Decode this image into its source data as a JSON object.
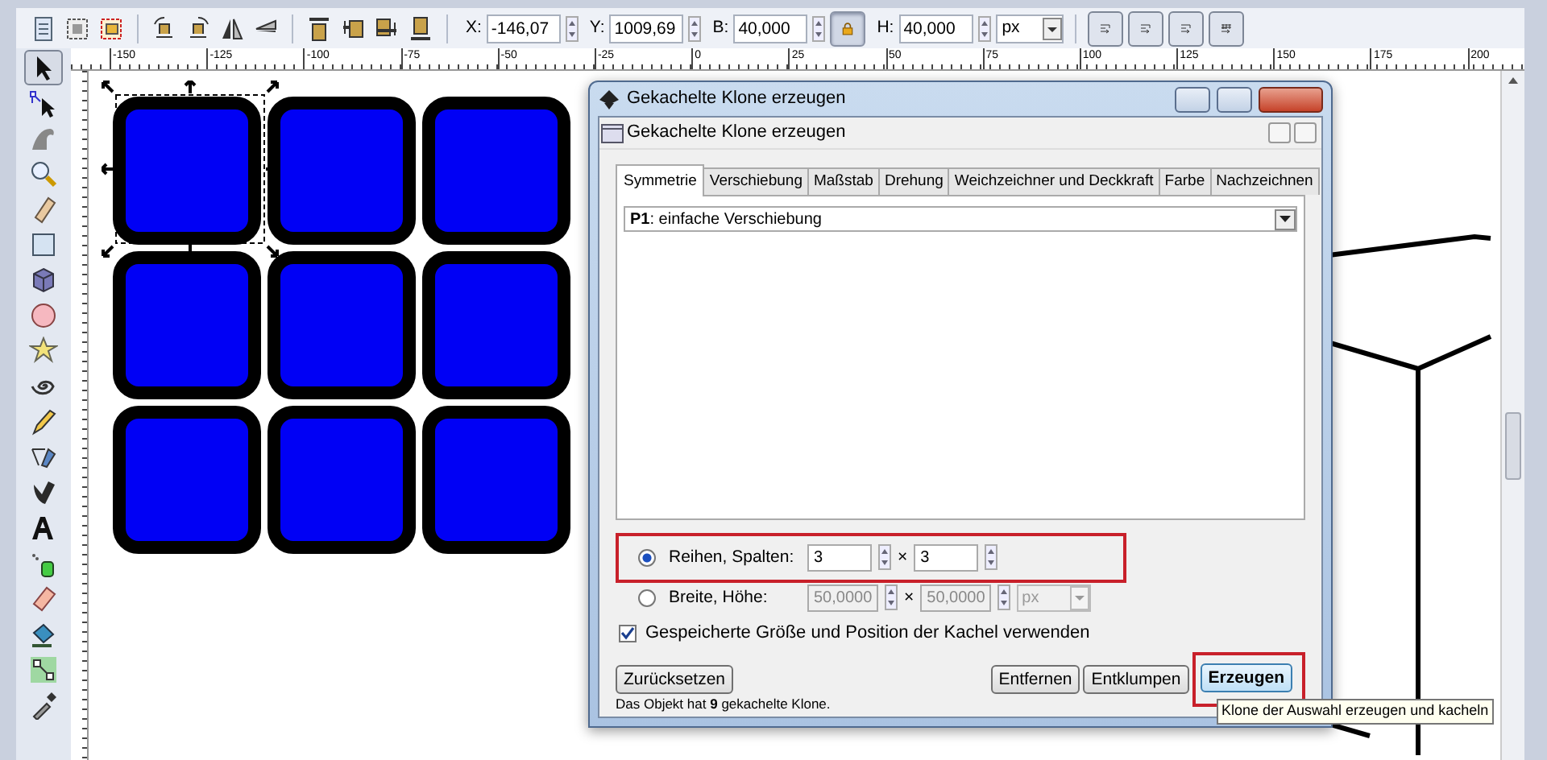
{
  "toolbar": {
    "items": [
      {
        "kind": "field",
        "label": "X:",
        "value": "-146,07"
      },
      {
        "kind": "field",
        "label": "Y:",
        "value": "1009,69"
      },
      {
        "kind": "field",
        "label": "B:",
        "value": "40,000"
      },
      {
        "kind": "lock",
        "on": true
      },
      {
        "kind": "field",
        "label": "H:",
        "value": "40,000"
      },
      {
        "kind": "unit",
        "value": "px"
      }
    ]
  },
  "ruler": {
    "labels": [
      "-150",
      "-125",
      "-100",
      "-75",
      "-50",
      "-25",
      "0",
      "25",
      "50",
      "75",
      "100",
      "125",
      "150",
      "175",
      "200"
    ]
  },
  "toolbox": {
    "tools": [
      {
        "kind": "selector",
        "selected": true
      },
      {
        "kind": "node",
        "selected": false
      },
      {
        "kind": "tweak",
        "selected": false
      },
      {
        "kind": "zoom",
        "selected": false
      },
      {
        "kind": "measure",
        "selected": false
      },
      {
        "kind": "rect",
        "selected": false
      },
      {
        "kind": "box3d",
        "selected": false
      },
      {
        "kind": "circle",
        "selected": false
      },
      {
        "kind": "star",
        "selected": false
      },
      {
        "kind": "spiral",
        "selected": false
      },
      {
        "kind": "pencil",
        "selected": false
      },
      {
        "kind": "pen",
        "selected": false
      },
      {
        "kind": "calligraphy",
        "selected": false
      },
      {
        "kind": "text",
        "selected": false
      },
      {
        "kind": "spray",
        "selected": false
      },
      {
        "kind": "eraser",
        "selected": false
      },
      {
        "kind": "bucket",
        "selected": false
      },
      {
        "kind": "connector",
        "selected": false
      },
      {
        "kind": "dropper",
        "selected": false
      }
    ]
  },
  "dialog": {
    "title": "Gekachelte Klone erzeugen",
    "panel_title": "Gekachelte Klone erzeugen",
    "tabs": [
      {
        "label": "Symmetrie",
        "selected": true
      },
      {
        "label": "Verschiebung",
        "selected": false
      },
      {
        "label": "Maßstab",
        "selected": false
      },
      {
        "label": "Drehung",
        "selected": false
      },
      {
        "label": "Weichzeichner und Deckkraft",
        "selected": false
      },
      {
        "label": "Farbe",
        "selected": false
      },
      {
        "label": "Nachzeichnen",
        "selected": false
      }
    ],
    "symmetry_select": {
      "value": "**P1**: einfache Verschiebung"
    },
    "size_options": [
      {
        "label": "Reihen, Spalten:",
        "selected": true,
        "highlighted": true,
        "disabled": false,
        "first": "3",
        "times": "×",
        "second": "3"
      },
      {
        "label": "Breite, Höhe:",
        "selected": false,
        "highlighted": false,
        "disabled": true,
        "first": "50,0000",
        "times": "×",
        "second": "50,0000",
        "unit": "px"
      }
    ],
    "checkbox": {
      "label": "Gespeicherte Größe und Position der Kachel verwenden",
      "checked": true
    },
    "buttons": [
      {
        "label": "Zurücksetzen",
        "kind": "left",
        "default": false,
        "highlighted": false
      },
      {
        "label": "Entfernen",
        "kind": "right",
        "default": false,
        "highlighted": false
      },
      {
        "label": "Entklumpen",
        "kind": "right",
        "default": false,
        "highlighted": false
      },
      {
        "label": "Erzeugen",
        "kind": "right",
        "default": true,
        "highlighted": true
      }
    ],
    "status": "Das Objekt hat **9** gekachelte Klone."
  },
  "tooltip": "Klone der Auswahl erzeugen und kacheln"
}
